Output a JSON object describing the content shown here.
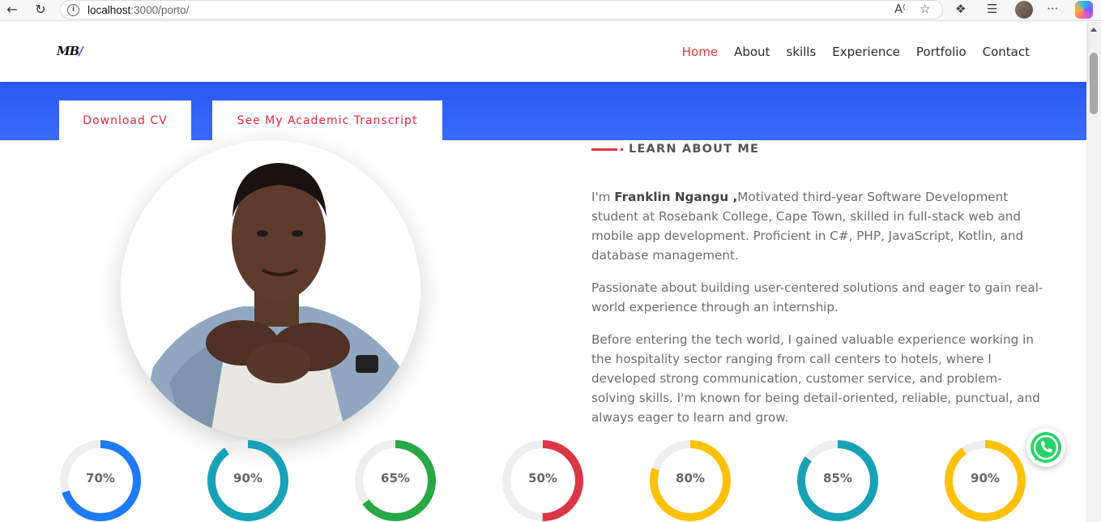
{
  "browser": {
    "url_host": "localhost",
    "url_rest": ":3000/porto/"
  },
  "header": {
    "logo": "MB",
    "nav": [
      {
        "label": "Home",
        "active": true
      },
      {
        "label": "About"
      },
      {
        "label": "skills"
      },
      {
        "label": "Experience"
      },
      {
        "label": "Portfolio"
      },
      {
        "label": "Contact"
      }
    ]
  },
  "hero": {
    "download_cv": "Download CV",
    "transcript": "See My Academic Transcript"
  },
  "about": {
    "heading": "LEARN ABOUT ME",
    "intro_prefix": "I'm ",
    "name": "Franklin Ngangu ,",
    "intro_rest": "Motivated third-year Software Development student at Rosebank College, Cape Town, skilled in full-stack web and mobile app development. Proficient in C#, PHP, JavaScript, Kotlin, and database management.",
    "paragraph2": "Passionate about building user-centered solutions and eager to gain real-world experience through an internship.",
    "paragraph3": "Before entering the tech world, I gained valuable experience working in the hospitality sector ranging from call centers to hotels, where I developed strong communication, customer service, and problem-solving skills. I'm known for being detail-oriented, reliable, punctual, and always eager to learn and grow."
  },
  "skills": [
    {
      "label": "70%",
      "value": 0.7,
      "color": "#1e7bf5"
    },
    {
      "label": "90%",
      "value": 0.9,
      "color": "#17a2b8"
    },
    {
      "label": "65%",
      "value": 0.65,
      "color": "#28a745"
    },
    {
      "label": "50%",
      "value": 0.5,
      "color": "#dc3545"
    },
    {
      "label": "80%",
      "value": 0.8,
      "color": "#ffc107"
    },
    {
      "label": "85%",
      "value": 0.85,
      "color": "#17a2b8"
    },
    {
      "label": "90%",
      "value": 0.9,
      "color": "#ffc107"
    }
  ],
  "colors": {
    "accent": "#e5343f",
    "band": "#2a59f4",
    "whatsapp": "#25d366"
  }
}
